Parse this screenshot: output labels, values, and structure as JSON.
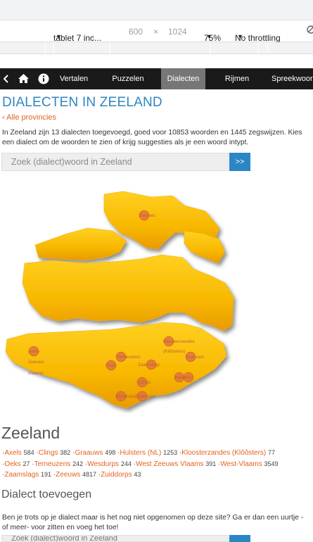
{
  "devtools": {
    "device": "tablet 7 inc...",
    "width": "600",
    "times": "×",
    "height": "1024",
    "zoom": "75%",
    "throttle": "No throttling"
  },
  "nav": {
    "items": [
      "Vertalen",
      "Puzzelen",
      "Dialecten",
      "Rijmen",
      "Spreekwoorden"
    ],
    "active": "Dialecten"
  },
  "page": {
    "title": "DIALECTEN IN ZEELAND",
    "back_link": "‹ Alle provincies",
    "intro": "In Zeeland zijn 13 dialecten toegevoegd, goed voor 10853 woorden en 1445 zegswijzen. Kies een dialect om de woorden te zien of krijg suggesties als je een woord intypt.",
    "search_placeholder": "Zoek (dialect)woord in Zeeland",
    "search_button": ">>"
  },
  "map": {
    "labels": [
      {
        "text": "Zeeuws"
      },
      {
        "text": "Kloosterzandes"
      },
      {
        "text": "(Klôôsters)"
      },
      {
        "text": "Axels"
      },
      {
        "text": "Terneuzens"
      },
      {
        "text": "Graauws"
      },
      {
        "text": "Zeeuws"
      },
      {
        "text": "Vlaams"
      },
      {
        "text": "Oeks"
      },
      {
        "text": "Zaamslags"
      },
      {
        "text": "Hulsters"
      },
      {
        "text": "Clings"
      },
      {
        "text": "Wesdurps"
      },
      {
        "text": "Zuiddorps"
      }
    ]
  },
  "province": {
    "name": "Zeeland",
    "dialects": [
      {
        "name": "Axels",
        "count": "584"
      },
      {
        "name": "Clings",
        "count": "382"
      },
      {
        "name": "Graauws",
        "count": "498"
      },
      {
        "name": "Hulsters (NL)",
        "count": "1253"
      },
      {
        "name": "Kloosterzandes (Klôôsters)",
        "count": "77"
      },
      {
        "name": "Oeks",
        "count": "27"
      },
      {
        "name": "Terneuzens",
        "count": "242"
      },
      {
        "name": "Wesdurps",
        "count": "244"
      },
      {
        "name": "West Zeeuws Vlaams",
        "count": "391"
      },
      {
        "name": "West-Vlaams",
        "count": "3549"
      },
      {
        "name": "Zaamslags",
        "count": "191"
      },
      {
        "name": "Zeeuws",
        "count": "4817"
      },
      {
        "name": "Zuiddorps",
        "count": "43"
      }
    ]
  },
  "add": {
    "title": "Dialect toevoegen",
    "text": "Ben je trots op je dialect maar is het nog niet opgenomen op deze site? Ga er dan een uurtje -of meer- voor zitten en voeg het toe!",
    "search_placeholder": "Zoek (dialect)woord in Zeeland"
  },
  "colors": {
    "accent_blue": "#2e86c1",
    "link_orange": "#e2631f",
    "map_gold": "#f5b800",
    "nav_bg": "#1a1a1a"
  }
}
